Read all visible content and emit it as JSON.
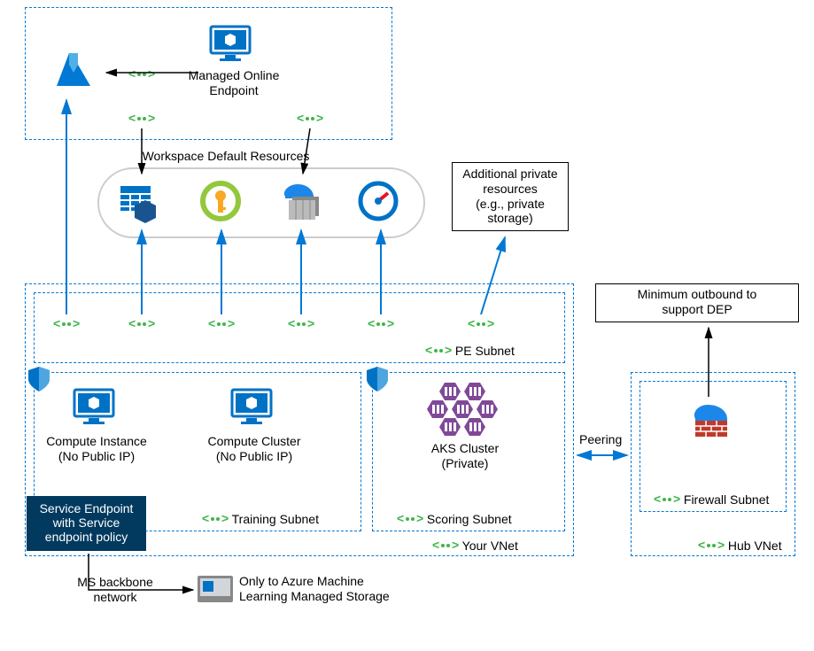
{
  "endpoint_label": "Managed Online\nEndpoint",
  "resources_header": "Workspace Default Resources",
  "private_resources": "Additional private\nresources\n(e.g., private\nstorage)",
  "pe_subnet": "PE Subnet",
  "compute_instance": "Compute Instance\n(No Public IP)",
  "compute_cluster": "Compute Cluster\n(No Public IP)",
  "aks_cluster": "AKS Cluster\n(Private)",
  "training_subnet": "Training Subnet",
  "scoring_subnet": "Scoring Subnet",
  "your_vnet": "Your VNet",
  "peering": "Peering",
  "hub_vnet": "Hub VNet",
  "firewall_subnet": "Firewall Subnet",
  "outbound": "Minimum outbound to\nsupport DEP",
  "sep_label": "Service Endpoint\nwith  Service\nendpoint policy",
  "ms_backbone": "MS backbone\nnetwork",
  "managed_storage": "Only to Azure Machine\nLearning Managed Storage",
  "icons": {
    "ml_workspace": "ml-workspace-icon",
    "monitor_box": "monitor-box-icon",
    "private_link": "private-link-icon",
    "storage": "storage-icon",
    "keyvault": "keyvault-icon",
    "container_registry": "container-registry-icon",
    "app_insights": "app-insights-icon",
    "shield": "shield-icon",
    "aks": "aks-icon",
    "firewall": "firewall-icon",
    "server_box": "server-box-icon"
  }
}
